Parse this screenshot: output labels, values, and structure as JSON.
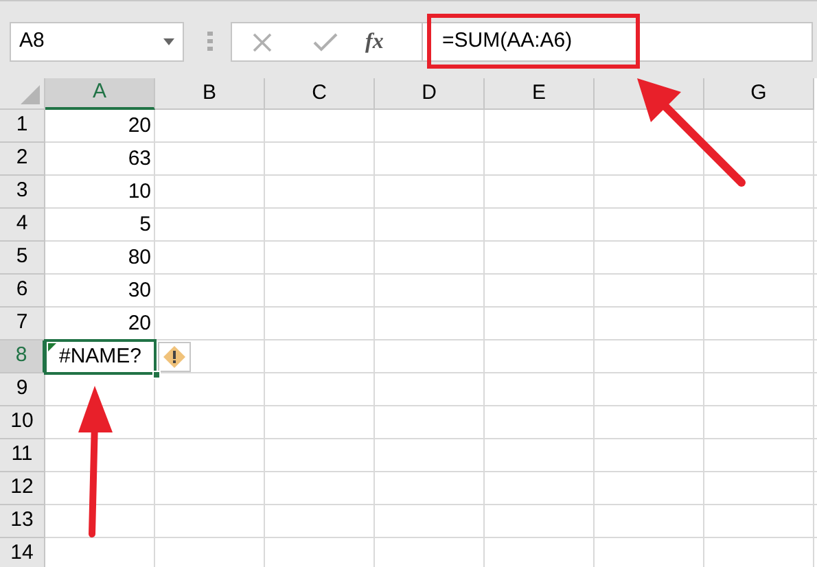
{
  "name_box": {
    "value": "A8"
  },
  "formula_bar": {
    "function_label": "fx",
    "formula": "=SUM(AA:A6)"
  },
  "columns": [
    {
      "label": "A",
      "selected": true
    },
    {
      "label": "B",
      "selected": false
    },
    {
      "label": "C",
      "selected": false
    },
    {
      "label": "D",
      "selected": false
    },
    {
      "label": "E",
      "selected": false
    },
    {
      "selected": false
    },
    {
      "label": "G",
      "selected": false
    }
  ],
  "rows": [
    {
      "number": "1",
      "value": "20",
      "kind": "number",
      "selected": false
    },
    {
      "number": "2",
      "value": "63",
      "kind": "number",
      "selected": false
    },
    {
      "number": "3",
      "value": "10",
      "kind": "number",
      "selected": false
    },
    {
      "number": "4",
      "value": "5",
      "kind": "number",
      "selected": false
    },
    {
      "number": "5",
      "value": "80",
      "kind": "number",
      "selected": false
    },
    {
      "number": "6",
      "value": "30",
      "kind": "number",
      "selected": false
    },
    {
      "number": "7",
      "value": "20",
      "kind": "number",
      "selected": false
    },
    {
      "number": "8",
      "value": "#NAME?",
      "kind": "error",
      "selected": true
    },
    {
      "number": "9",
      "selected": false
    },
    {
      "number": "10",
      "selected": false
    },
    {
      "number": "11",
      "selected": false
    },
    {
      "number": "12",
      "selected": false
    },
    {
      "number": "13",
      "selected": false
    },
    {
      "number": "14",
      "selected": false
    }
  ]
}
